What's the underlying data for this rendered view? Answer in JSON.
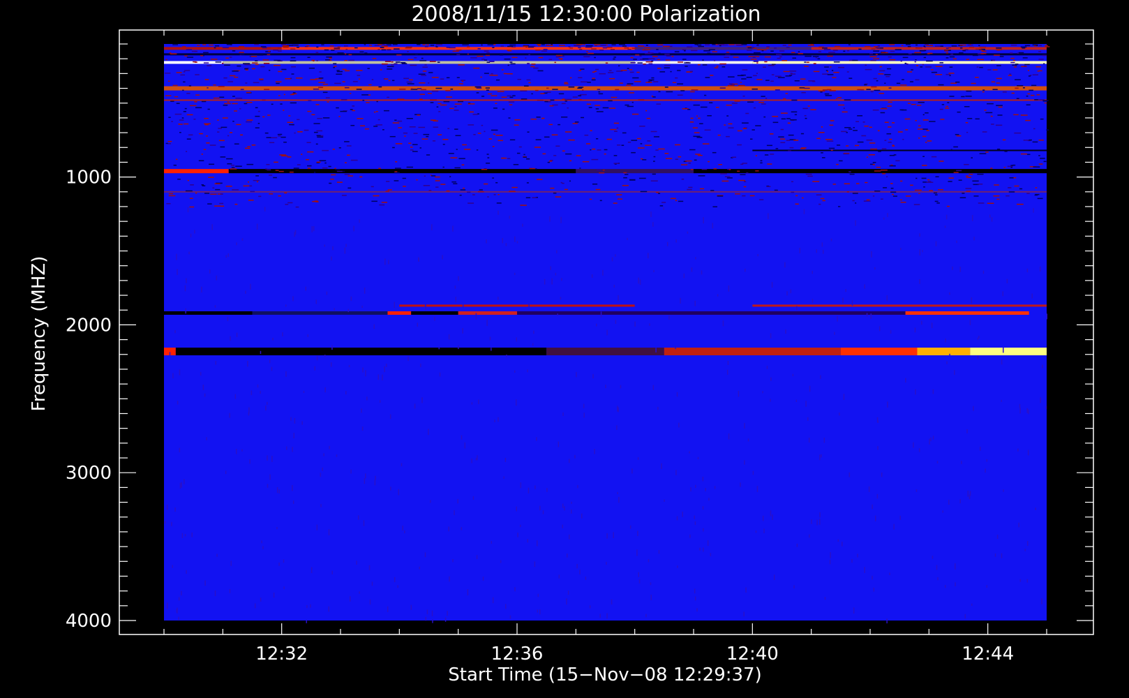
{
  "chart_data": {
    "type": "heatmap",
    "title": "2008/11/15 12:30:00 Polarization",
    "xlabel": "Start Time (15−Nov−08 12:29:37)",
    "ylabel": "Frequency (MHZ)",
    "x_ticks": [
      "12:32",
      "12:36",
      "12:40",
      "12:44"
    ],
    "x_tick_minutes": [
      32,
      36,
      40,
      44
    ],
    "x_range_minutes": [
      30,
      45
    ],
    "y_ticks": [
      1000,
      2000,
      3000,
      4000
    ],
    "y_range": [
      100,
      4000
    ],
    "y_inverted": true,
    "colormap": [
      "#000000",
      "#0000ff",
      "#ff0000",
      "#ffff00",
      "#ffffff"
    ],
    "background_color": "#1010f0",
    "features": [
      {
        "freq_mhz": 130,
        "note": "dense RFI band"
      },
      {
        "freq_mhz": 225,
        "note": "bright white/yellow band"
      },
      {
        "freq_mhz": 400,
        "note": "orange speckled band"
      },
      {
        "freq_mhz": 960,
        "note": "red then dark band"
      },
      {
        "freq_mhz": 1920,
        "note": "dark/red mixed band"
      },
      {
        "freq_mhz": 2180,
        "note": "dark early, bright yellow late band"
      }
    ]
  }
}
